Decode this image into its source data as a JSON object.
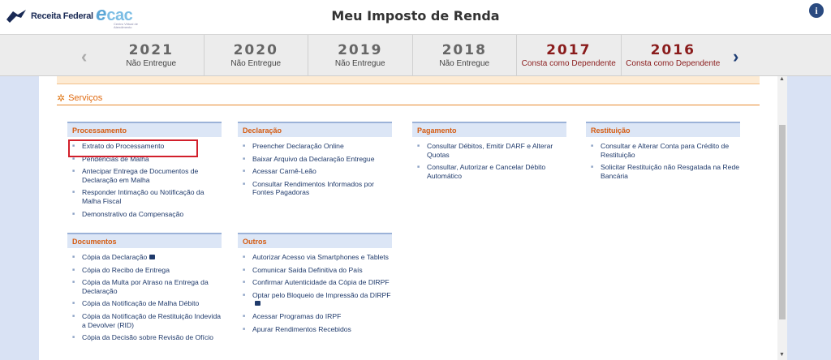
{
  "header": {
    "logo_text": "Receita Federal",
    "ecac_e": "e",
    "ecac_cac": "cac",
    "ecac_sub": "Centro Virtual de Atendimento",
    "title": "Meu Imposto de Renda",
    "info_label": "i"
  },
  "years": [
    {
      "year": "2021",
      "status": "Não Entregue"
    },
    {
      "year": "2020",
      "status": "Não Entregue"
    },
    {
      "year": "2019",
      "status": "Não Entregue"
    },
    {
      "year": "2018",
      "status": "Não Entregue"
    },
    {
      "year": "2017",
      "status": "Consta como Dependente"
    },
    {
      "year": "2016",
      "status": "Consta como Dependente"
    }
  ],
  "nav": {
    "prev": "‹",
    "next": "›"
  },
  "services": {
    "title": "Serviços",
    "processamento": {
      "title": "Processamento",
      "items": [
        "Extrato do Processamento",
        "Pendências de Malha",
        "Antecipar Entrega de Documentos de Declaração em Malha",
        "Responder Intimação ou Notificação da Malha Fiscal",
        "Demonstrativo da Compensação"
      ]
    },
    "declaracao": {
      "title": "Declaração",
      "items": [
        "Preencher Declaração Online",
        "Baixar Arquivo da Declaração Entregue",
        "Acessar Carnê-Leão",
        "Consultar Rendimentos Informados por Fontes Pagadoras"
      ]
    },
    "pagamento": {
      "title": "Pagamento",
      "items": [
        "Consultar Débitos, Emitir DARF e Alterar Quotas",
        "Consultar, Autorizar e Cancelar Débito Automático"
      ]
    },
    "restituicao": {
      "title": "Restituição",
      "items": [
        "Consultar e Alterar Conta para Crédito de Restituição",
        "Solicitar Restituição não Resgatada na Rede Bancária"
      ]
    },
    "documentos": {
      "title": "Documentos",
      "items": [
        "Cópia da Declaração",
        "Cópia do Recibo de Entrega",
        "Cópia da Multa por Atraso na Entrega da Declaração",
        "Cópia da Notificação de Malha Débito",
        "Cópia da Notificação de Restituição Indevida a Devolver (RID)",
        "Cópia da Decisão sobre Revisão de Ofício"
      ]
    },
    "outros": {
      "title": "Outros",
      "items": [
        "Autorizar Acesso via Smartphones e Tablets",
        "Comunicar Saída Definitiva do País",
        "Confirmar Autenticidade da Cópia de DIRPF",
        "Optar pelo Bloqueio de Impressão da DIRPF",
        "Acessar Programas do IRPF",
        "Apurar Rendimentos Recebidos"
      ]
    }
  }
}
